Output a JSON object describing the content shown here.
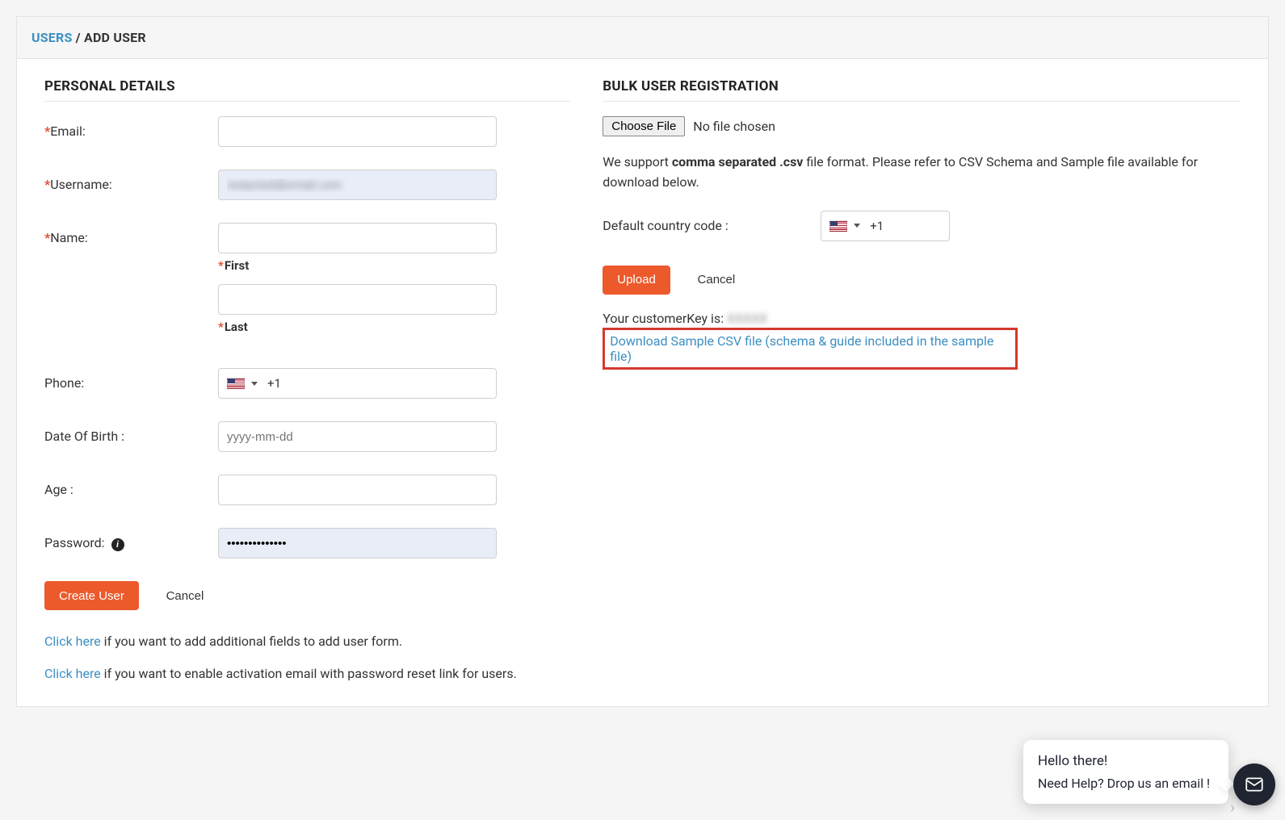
{
  "breadcrumb": {
    "users": "USERS",
    "sep": " / ",
    "current": "ADD USER"
  },
  "left": {
    "title": "PERSONAL DETAILS",
    "email_label": "Email:",
    "username_label": "Username:",
    "username_value": "redacted@email.com",
    "name_label": "Name:",
    "first_label": "First",
    "last_label": "Last",
    "phone_label": "Phone:",
    "phone_dialcode": "+1",
    "dob_label": "Date Of Birth :",
    "dob_placeholder": "yyyy-mm-dd",
    "age_label": "Age :",
    "password_label": "Password:",
    "password_value": "••••••••••••••",
    "create_btn": "Create User",
    "cancel_btn": "Cancel",
    "helper1_link": "Click here",
    "helper1_text": " if you want to add additional fields to add user form.",
    "helper2_link": "Click here",
    "helper2_text": " if you want to enable activation email with password reset link for users."
  },
  "right": {
    "title": "BULK USER REGISTRATION",
    "choose_file": "Choose File",
    "no_file": "No file chosen",
    "support_pre": "We support ",
    "support_bold": "comma separated .csv",
    "support_post": " file format. Please refer to CSV Schema and Sample file available for download below.",
    "country_label": "Default country code :",
    "country_dialcode": "+1",
    "upload_btn": "Upload",
    "cancel_btn": "Cancel",
    "ckey_label": "Your customerKey is: ",
    "ckey_value": "XXXXX",
    "download_link": "Download Sample CSV file (schema & guide included in the sample file)"
  },
  "chat": {
    "line1": "Hello there!",
    "line2": "Need Help? Drop us an email !"
  }
}
